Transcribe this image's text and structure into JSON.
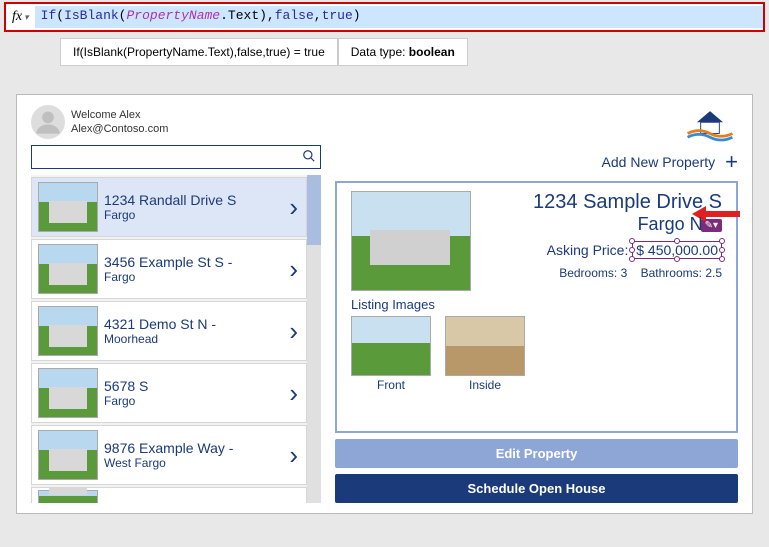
{
  "formula": {
    "fn_if": "If",
    "fn_isblank": "IsBlank",
    "prop": "PropertyName",
    "dot_text": ".Text)",
    "comma1": ",",
    "lit_false": "false",
    "comma2": ",",
    "lit_true": "true",
    "close": ")",
    "raw": "If(IsBlank(PropertyName.Text),false,true)"
  },
  "eval": {
    "expr": "If(IsBlank(PropertyName.Text),false,true)  =  true",
    "datatype_label": "Data type: ",
    "datatype_value": "boolean"
  },
  "user": {
    "welcome": "Welcome Alex",
    "email": "Alex@Contoso.com"
  },
  "search": {
    "placeholder": ""
  },
  "gallery": [
    {
      "title": "1234 Randall Drive S",
      "subtitle": "Fargo"
    },
    {
      "title": "3456 Example St S -",
      "subtitle": "Fargo"
    },
    {
      "title": "4321 Demo St N -",
      "subtitle": "Moorhead"
    },
    {
      "title": "5678 S",
      "subtitle": "Fargo"
    },
    {
      "title": "9876 Example Way -",
      "subtitle": "West Fargo"
    }
  ],
  "addnew": {
    "label": "Add New Property"
  },
  "detail": {
    "name": "1234 Sample Drive S",
    "city": "Fargo N",
    "price_label": "Asking Price:",
    "price_value": "$ 450,000.00",
    "bedrooms_label": "Bedrooms:",
    "bedrooms_value": "3",
    "bathrooms_label": "Bathrooms:",
    "bathrooms_value": "2.5",
    "listing_label": "Listing Images",
    "images": [
      {
        "caption": "Front"
      },
      {
        "caption": "Inside"
      }
    ]
  },
  "buttons": {
    "edit": "Edit Property",
    "schedule": "Schedule Open House"
  }
}
